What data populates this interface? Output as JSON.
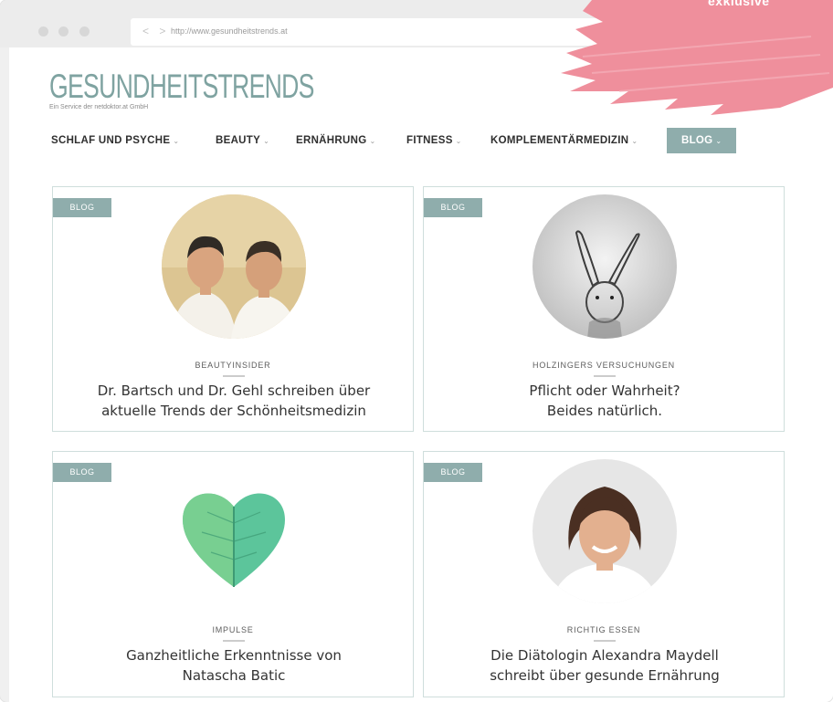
{
  "browser": {
    "nav_arrows": "< >",
    "url": "http://www.gesundheitstrends.at"
  },
  "site": {
    "logo": "GESUNDHEITSTRENDS",
    "tagline": "Ein Service der netdoktor.at GmbH",
    "accent_color": "#8fadac",
    "logo_color": "#7fa3a1"
  },
  "nav": {
    "items": [
      {
        "label": "SCHLAF UND PSYCHE"
      },
      {
        "label": "BEAUTY"
      },
      {
        "label": "ERNÄHRUNG"
      },
      {
        "label": "FITNESS"
      },
      {
        "label": "KOMPLEMENTÄRMEDIZIN"
      },
      {
        "label": "BLOG"
      }
    ],
    "chevron": "⌄",
    "active": "BLOG"
  },
  "cards": [
    {
      "badge": "BLOG",
      "image": "two-men-portrait",
      "category": "BEAUTYINSIDER",
      "title_lines": [
        "Dr. Bartsch und Dr. Gehl schreiben über",
        "aktuelle Trends der Schönheitsmedizin"
      ]
    },
    {
      "badge": "BLOG",
      "image": "rabbit-illustration",
      "category": "HOLZINGERS VERSUCHUNGEN",
      "title_lines": [
        "Pflicht oder Wahrheit?",
        "Beides natürlich."
      ]
    },
    {
      "badge": "BLOG",
      "image": "leaf-heart",
      "category": "IMPULSE",
      "title_lines": [
        "Ganzheitliche Erkenntnisse von",
        "Natascha Batic"
      ]
    },
    {
      "badge": "BLOG",
      "image": "woman-portrait",
      "category": "RICHTIG ESSEN",
      "title_lines": [
        "Die Diätologin Alexandra Maydell",
        "schreibt über gesunde Ernährung"
      ]
    }
  ],
  "overlay": {
    "text": "exklusive",
    "color": "#ef8f9c"
  }
}
